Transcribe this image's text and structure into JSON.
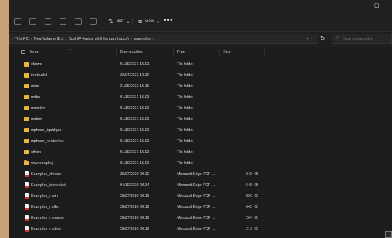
{
  "window": {
    "min_glyph": "–",
    "max_glyph": "▢"
  },
  "toolbar": {
    "sort_label": "Sort",
    "view_label": "View",
    "sort_glyph": "⇅",
    "view_glyph": "≡",
    "more_glyph": "•••"
  },
  "address": {
    "lead_glyph": "›",
    "crumbs": [
      "This PC",
      "New Volume (D:)",
      "DualSPHysics_v5.0 (jangan hapus)",
      "examples"
    ],
    "separator": "›",
    "dropdown_glyph": "⌄",
    "refresh_glyph": "↻"
  },
  "search": {
    "placeholder": "Search examples",
    "icon_glyph": "⌕"
  },
  "columns": {
    "name": "Name",
    "date": "Date modified",
    "type": "Type",
    "size": "Size",
    "sort_caret": "^"
  },
  "files": [
    {
      "name": "chrono",
      "date": "01/10/2021 15.01",
      "type": "File folder",
      "size": "",
      "icon": "folder"
    },
    {
      "name": "inletoutlet",
      "date": "22/04/2022 13.32",
      "type": "File folder",
      "size": "",
      "icon": "folder"
    },
    {
      "name": "main",
      "date": "21/05/2022 15.19",
      "type": "File folder",
      "size": "",
      "icon": "folder"
    },
    {
      "name": "mdbc",
      "date": "01/10/2021 15.03",
      "type": "File folder",
      "size": "",
      "icon": "folder"
    },
    {
      "name": "moordyn",
      "date": "01/10/2021 15.03",
      "type": "File folder",
      "size": "",
      "icon": "folder"
    },
    {
      "name": "motion",
      "date": "01/10/2021 15.03",
      "type": "File folder",
      "size": "",
      "icon": "folder"
    },
    {
      "name": "mphase_liquidgas",
      "date": "01/10/2021 15.03",
      "type": "File folder",
      "size": "",
      "icon": "folder"
    },
    {
      "name": "mphase_newtonian",
      "date": "01/10/2021 15.03",
      "type": "File folder",
      "size": "",
      "icon": "folder"
    },
    {
      "name": "others",
      "date": "01/10/2021 15.03",
      "type": "File folder",
      "size": "",
      "icon": "folder"
    },
    {
      "name": "wavecoupling",
      "date": "01/10/2021 15.03",
      "type": "File folder",
      "size": "",
      "icon": "folder"
    },
    {
      "name": "Examples_chrono",
      "date": "28/07/2020 00.12",
      "type": "Microsoft Edge PDF ...",
      "size": "848 KB",
      "icon": "pdf"
    },
    {
      "name": "Examples_inletoutlet",
      "date": "04/10/2020 00.34",
      "type": "Microsoft Edge PDF ...",
      "size": "645 KB",
      "icon": "pdf"
    },
    {
      "name": "Examples_main",
      "date": "28/07/2020 00.12",
      "type": "Microsoft Edge PDF ...",
      "size": "856 KB",
      "icon": "pdf"
    },
    {
      "name": "Examples_mdbc",
      "date": "28/07/2020 00.12",
      "type": "Microsoft Edge PDF ...",
      "size": "645 KB",
      "icon": "pdf"
    },
    {
      "name": "Examples_moordyn",
      "date": "28/07/2020 00.12",
      "type": "Microsoft Edge PDF ...",
      "size": "264 KB",
      "icon": "pdf"
    },
    {
      "name": "Examples_motion",
      "date": "28/07/2020 00.12",
      "type": "Microsoft Edge PDF ...",
      "size": "219 KB",
      "icon": "pdf"
    }
  ]
}
